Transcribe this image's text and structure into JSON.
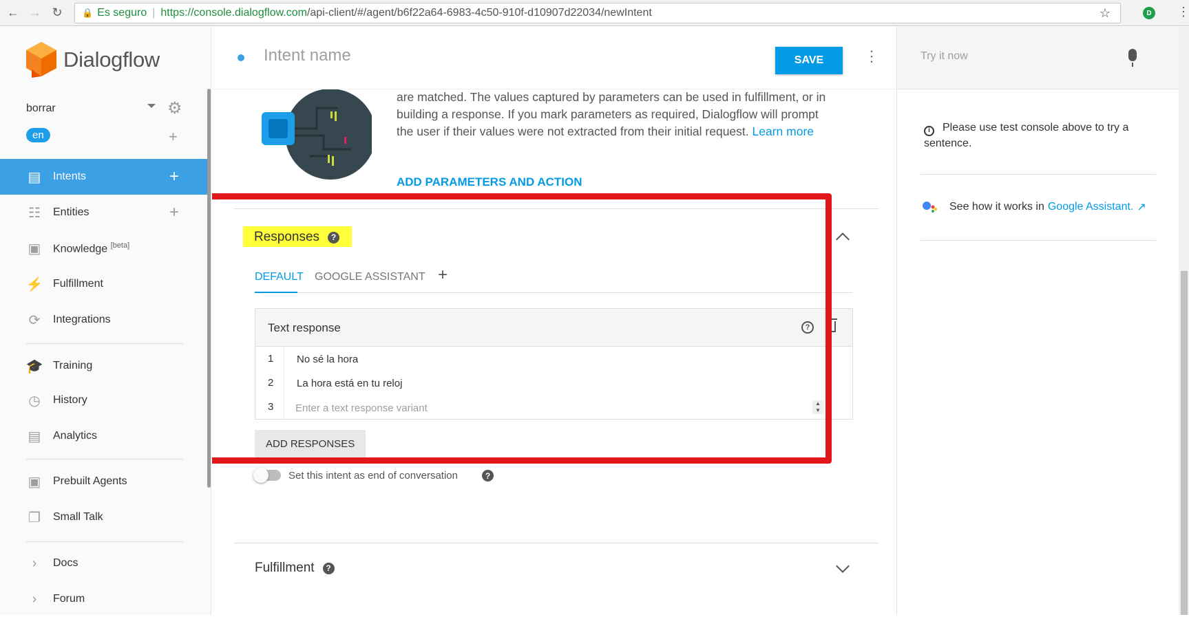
{
  "browser": {
    "secure_label": "Es seguro",
    "url_host": "https://console.dialogflow.com",
    "url_path": "/api-client/#/agent/b6f22a64-6983-4c50-910f-d10907d22034/newIntent"
  },
  "sidebar": {
    "logo_text": "Dialogflow",
    "agent_name": "borrar",
    "language": "en",
    "items": [
      {
        "label": "Intents"
      },
      {
        "label": "Entities"
      },
      {
        "label": "Knowledge",
        "badge": "[beta]"
      },
      {
        "label": "Fulfillment"
      },
      {
        "label": "Integrations"
      },
      {
        "label": "Training"
      },
      {
        "label": "History"
      },
      {
        "label": "Analytics"
      },
      {
        "label": "Prebuilt Agents"
      },
      {
        "label": "Small Talk"
      },
      {
        "label": "Docs"
      },
      {
        "label": "Forum"
      }
    ]
  },
  "header": {
    "intent_placeholder": "Intent name",
    "save_label": "SAVE"
  },
  "params": {
    "description": "are matched. The values captured by parameters can be used in fulfillment, or in building a response. If you mark parameters as required, Dialogflow will prompt the user if their values were not extracted from their initial request.",
    "learn_more": "Learn more",
    "add_params_label": "ADD PARAMETERS AND ACTION"
  },
  "responses": {
    "title": "Responses",
    "tabs": [
      {
        "label": "DEFAULT"
      },
      {
        "label": "GOOGLE ASSISTANT"
      }
    ],
    "card_title": "Text response",
    "rows": [
      {
        "num": "1",
        "text": "No sé la hora"
      },
      {
        "num": "2",
        "text": "La hora está en tu reloj"
      },
      {
        "num": "3",
        "placeholder": "Enter a text response variant"
      }
    ],
    "add_responses_label": "ADD RESPONSES",
    "end_conversation_label": "Set this intent as end of conversation"
  },
  "fulfillment": {
    "title": "Fulfillment"
  },
  "right_panel": {
    "try_placeholder": "Try it now",
    "info_text": "Please use test console above to try a sentence.",
    "ga_text": "See how it works in",
    "ga_link": "Google Assistant."
  },
  "colors": {
    "accent": "#039be5",
    "active_nav": "#3ba0e4",
    "highlight": "#ffff3b",
    "annotation_red": "#e2171b"
  }
}
